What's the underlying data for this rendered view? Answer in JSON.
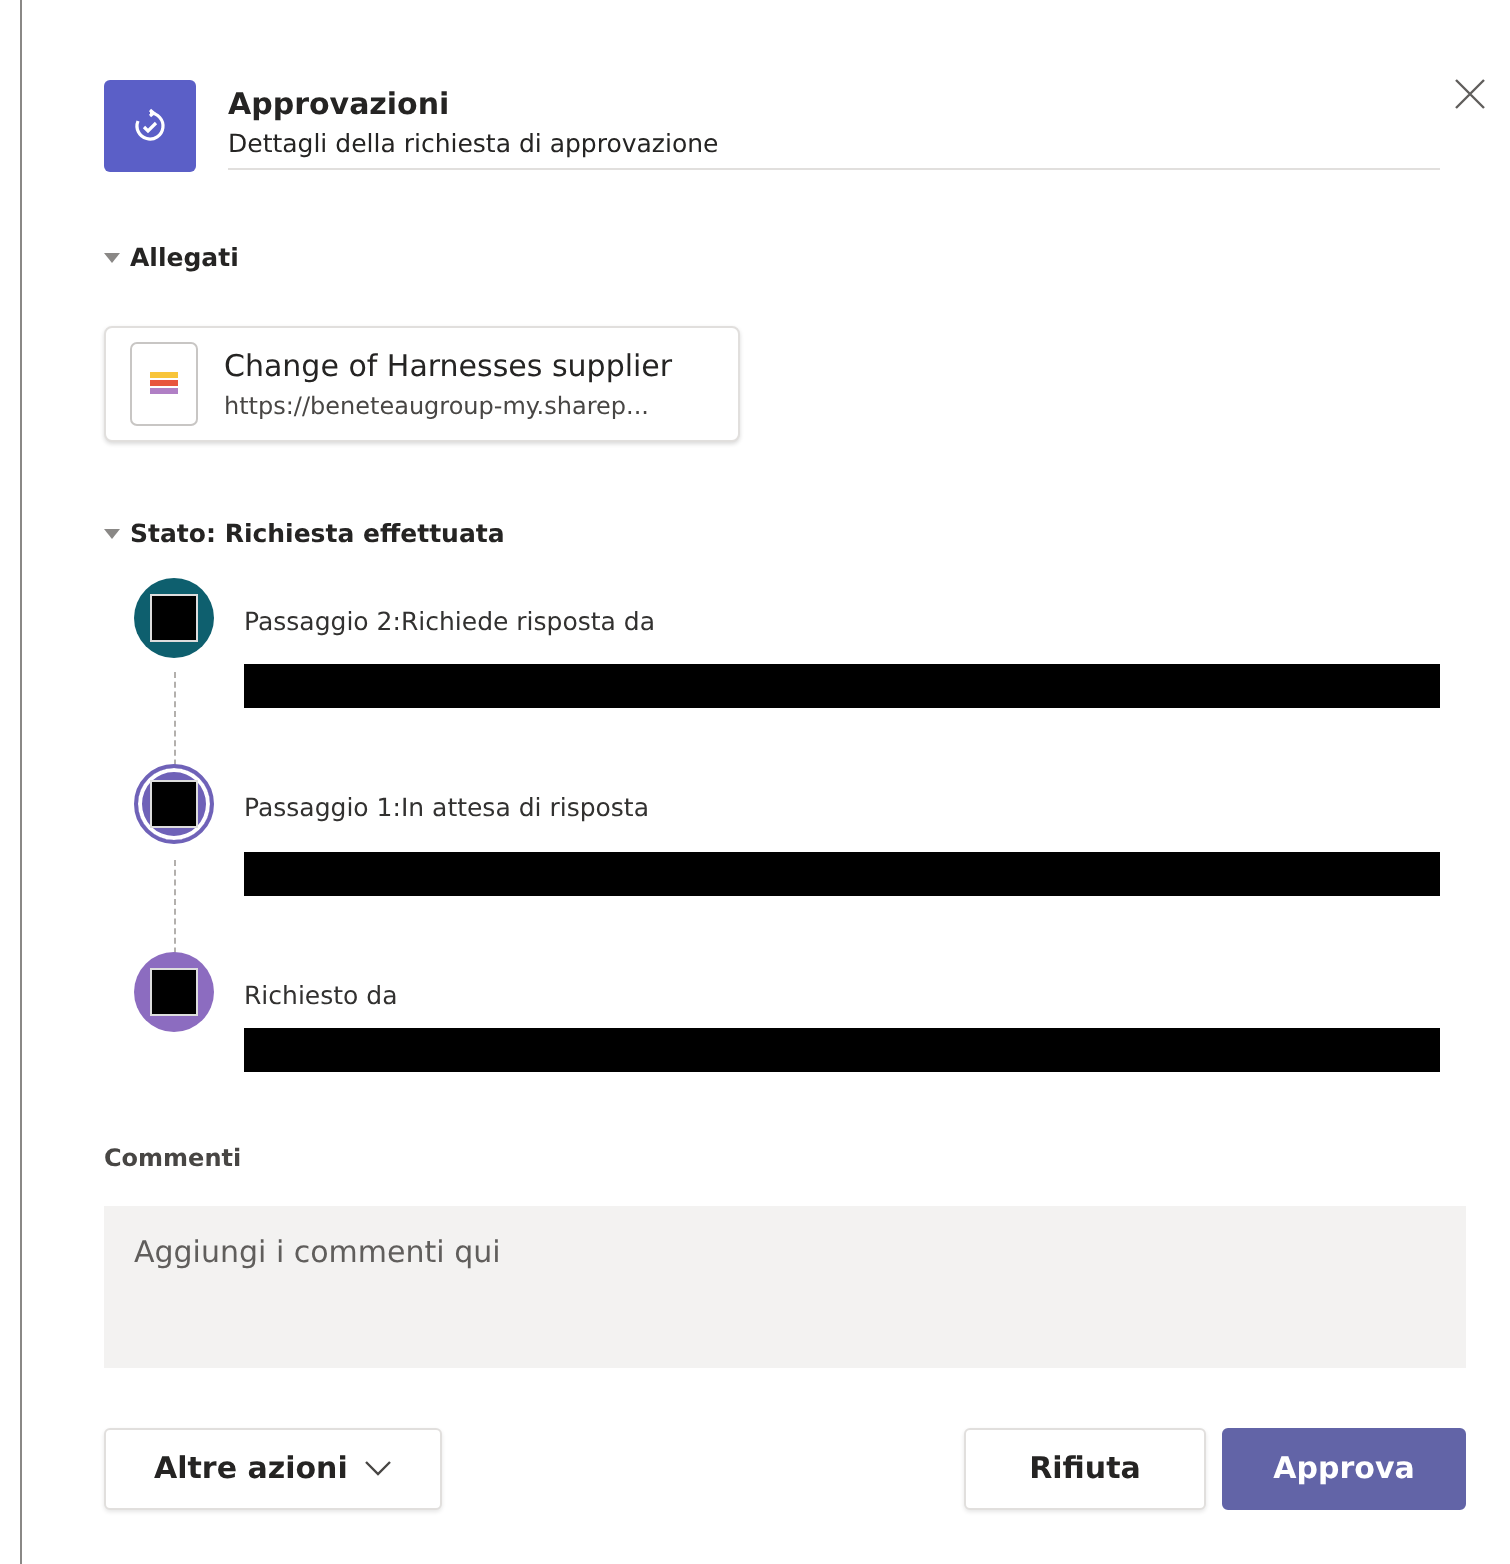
{
  "header": {
    "title": "Approvazioni",
    "subtitle": "Dettagli della richiesta di approvazione"
  },
  "attachments": {
    "heading": "Allegati",
    "expanded": true,
    "files": [
      {
        "name": "Change of Harnesses supplier",
        "url": "https://beneteaugroup-my.sharep..."
      }
    ]
  },
  "status": {
    "heading": "Stato: Richiesta effettuata",
    "expanded": true,
    "steps": [
      {
        "label": "Passaggio 2:Richiede risposta da",
        "kind": "filled",
        "color": "#0e5f6e"
      },
      {
        "label": "Passaggio 1:In attesa di risposta",
        "kind": "ring",
        "color": "#6f62b8"
      },
      {
        "label": "Richiesto da",
        "kind": "filled",
        "color": "#8c6cc0"
      }
    ]
  },
  "comments": {
    "label": "Commenti",
    "placeholder": "Aggiungi i commenti qui"
  },
  "buttons": [
    {
      "label": "Altre azioni",
      "kind": "menu"
    },
    {
      "label": "Rifiuta",
      "kind": "secondary"
    },
    {
      "label": "Approva",
      "kind": "primary"
    }
  ]
}
